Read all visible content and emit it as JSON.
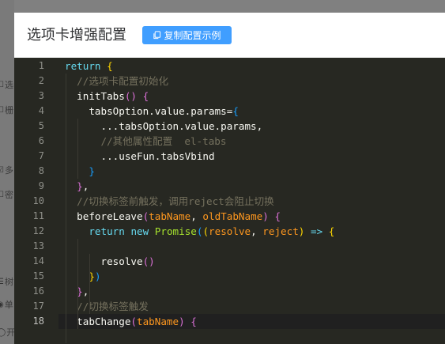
{
  "background": {
    "items": [
      {
        "icon": "☐",
        "label": "选"
      },
      {
        "icon": "☐",
        "label": "栅"
      },
      {
        "icon": "☑",
        "label": "多"
      },
      {
        "icon": "☐",
        "label": "密"
      },
      {
        "icon": "☰",
        "label": "树"
      },
      {
        "icon": "◉",
        "label": "单"
      },
      {
        "icon": "◯",
        "label": "开"
      }
    ]
  },
  "dialog": {
    "title": "选项卡增强配置",
    "copy_button_label": "复制配置示例"
  },
  "editor": {
    "active_line": 18,
    "lines": [
      {
        "n": "1",
        "tokens": [
          [
            "kw",
            "return"
          ],
          [
            "pl",
            " "
          ],
          [
            "br1",
            "{"
          ]
        ]
      },
      {
        "n": "2",
        "tokens": [
          [
            "pl",
            "  "
          ],
          [
            "cm",
            "//选项卡配置初始化"
          ]
        ]
      },
      {
        "n": "3",
        "tokens": [
          [
            "pl",
            "  "
          ],
          [
            "id",
            "initTabs"
          ],
          [
            "br2",
            "()"
          ],
          [
            "pl",
            " "
          ],
          [
            "br2",
            "{"
          ]
        ]
      },
      {
        "n": "4",
        "tokens": [
          [
            "pl",
            "    "
          ],
          [
            "id",
            "tabsOption.value.params"
          ],
          [
            "pl",
            "="
          ],
          [
            "br3",
            "{"
          ]
        ]
      },
      {
        "n": "5",
        "tokens": [
          [
            "pl",
            "      "
          ],
          [
            "id",
            "...tabsOption.value.params,"
          ]
        ]
      },
      {
        "n": "6",
        "tokens": [
          [
            "pl",
            "      "
          ],
          [
            "cm",
            "//其他属性配置  el-tabs"
          ]
        ]
      },
      {
        "n": "7",
        "tokens": [
          [
            "pl",
            "      "
          ],
          [
            "id",
            "...useFun.tabsVbind"
          ]
        ]
      },
      {
        "n": "8",
        "tokens": [
          [
            "pl",
            "    "
          ],
          [
            "br3",
            "}"
          ]
        ]
      },
      {
        "n": "9",
        "tokens": [
          [
            "pl",
            "  "
          ],
          [
            "br2",
            "}"
          ],
          [
            "pl",
            ","
          ]
        ]
      },
      {
        "n": "10",
        "tokens": [
          [
            "pl",
            "  "
          ],
          [
            "cm",
            "//切换标签前触发，调用reject会阻止切换"
          ]
        ]
      },
      {
        "n": "11",
        "tokens": [
          [
            "pl",
            "  "
          ],
          [
            "id",
            "beforeLeave"
          ],
          [
            "br2",
            "("
          ],
          [
            "pm",
            "tabName"
          ],
          [
            "pl",
            ", "
          ],
          [
            "pm",
            "oldTabName"
          ],
          [
            "br2",
            ")"
          ],
          [
            "pl",
            " "
          ],
          [
            "br2",
            "{"
          ]
        ]
      },
      {
        "n": "12",
        "tokens": [
          [
            "pl",
            "    "
          ],
          [
            "kw",
            "return"
          ],
          [
            "pl",
            " "
          ],
          [
            "kw",
            "new"
          ],
          [
            "pl",
            " "
          ],
          [
            "fn",
            "Promise"
          ],
          [
            "br3",
            "("
          ],
          [
            "br1",
            "("
          ],
          [
            "pm",
            "resolve"
          ],
          [
            "pl",
            ", "
          ],
          [
            "pm",
            "reject"
          ],
          [
            "br1",
            ")"
          ],
          [
            "pl",
            " "
          ],
          [
            "kw",
            "=>"
          ],
          [
            "pl",
            " "
          ],
          [
            "br1",
            "{"
          ]
        ]
      },
      {
        "n": "13",
        "tokens": []
      },
      {
        "n": "14",
        "tokens": [
          [
            "pl",
            "      "
          ],
          [
            "id",
            "resolve"
          ],
          [
            "br2",
            "()"
          ]
        ]
      },
      {
        "n": "15",
        "tokens": [
          [
            "pl",
            "    "
          ],
          [
            "br1",
            "}"
          ],
          [
            "br3",
            ")"
          ]
        ]
      },
      {
        "n": "16",
        "tokens": [
          [
            "pl",
            "  "
          ],
          [
            "br2",
            "}"
          ],
          [
            "pl",
            ","
          ]
        ]
      },
      {
        "n": "17",
        "tokens": [
          [
            "pl",
            "  "
          ],
          [
            "cm",
            "//切换标签触发"
          ]
        ]
      },
      {
        "n": "18",
        "tokens": [
          [
            "pl",
            "  "
          ],
          [
            "id",
            "tabChange"
          ],
          [
            "br2",
            "("
          ],
          [
            "pm",
            "tabName"
          ],
          [
            "br2",
            ")"
          ],
          [
            "pl",
            " "
          ],
          [
            "br2",
            "{"
          ]
        ]
      }
    ]
  },
  "colors": {
    "accent": "#409eff",
    "editor_bg": "#272822",
    "keyword": "#66d9ef",
    "comment": "#75715e",
    "function": "#a6e22e",
    "param": "#fd971f"
  }
}
